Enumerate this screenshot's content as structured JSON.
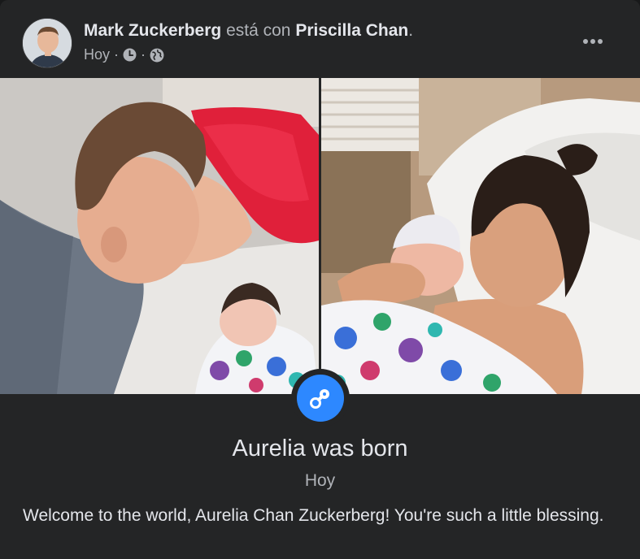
{
  "post": {
    "author": "Mark Zuckerberg",
    "with_text": "está con",
    "tagged": "Priscilla Chan",
    "tagged_suffix": ".",
    "time": "Hoy",
    "separator": "·",
    "privacy_icon": "globe-icon",
    "clock_icon": "clock-icon",
    "more_icon": "more-horizontal-icon"
  },
  "photos": [
    {
      "subject": "father-with-newborn"
    },
    {
      "subject": "mother-with-newborn"
    }
  ],
  "life_event": {
    "icon": "pacifier-icon",
    "title": "Aurelia was born",
    "date": "Hoy"
  },
  "caption": "Welcome to the world, Aurelia Chan Zuckerberg! You're such a little blessing.",
  "colors": {
    "card_bg": "#242526",
    "primary_text": "#e4e6eb",
    "secondary_text": "#b0b3b8",
    "accent": "#2d88ff"
  }
}
